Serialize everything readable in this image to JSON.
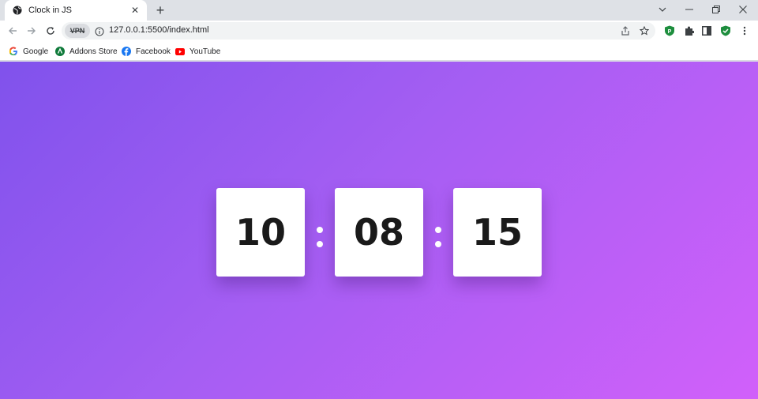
{
  "tab": {
    "title": "Clock in JS",
    "close_label": "✕"
  },
  "toolbar": {
    "vpn_label": "VPN",
    "url": "127.0.0.1:5500/index.html"
  },
  "bookmarks": [
    {
      "label": "Google",
      "icon": "google-icon"
    },
    {
      "label": "Addons Store",
      "icon": "addons-store-icon"
    },
    {
      "label": "Facebook",
      "icon": "facebook-icon"
    },
    {
      "label": "YouTube",
      "icon": "youtube-icon"
    }
  ],
  "clock": {
    "hours": "10",
    "minutes": "08",
    "seconds": "15"
  },
  "colors": {
    "gradient_start": "#8052ec",
    "gradient_end": "#d160fa",
    "digit_color": "#1a1a1a"
  }
}
